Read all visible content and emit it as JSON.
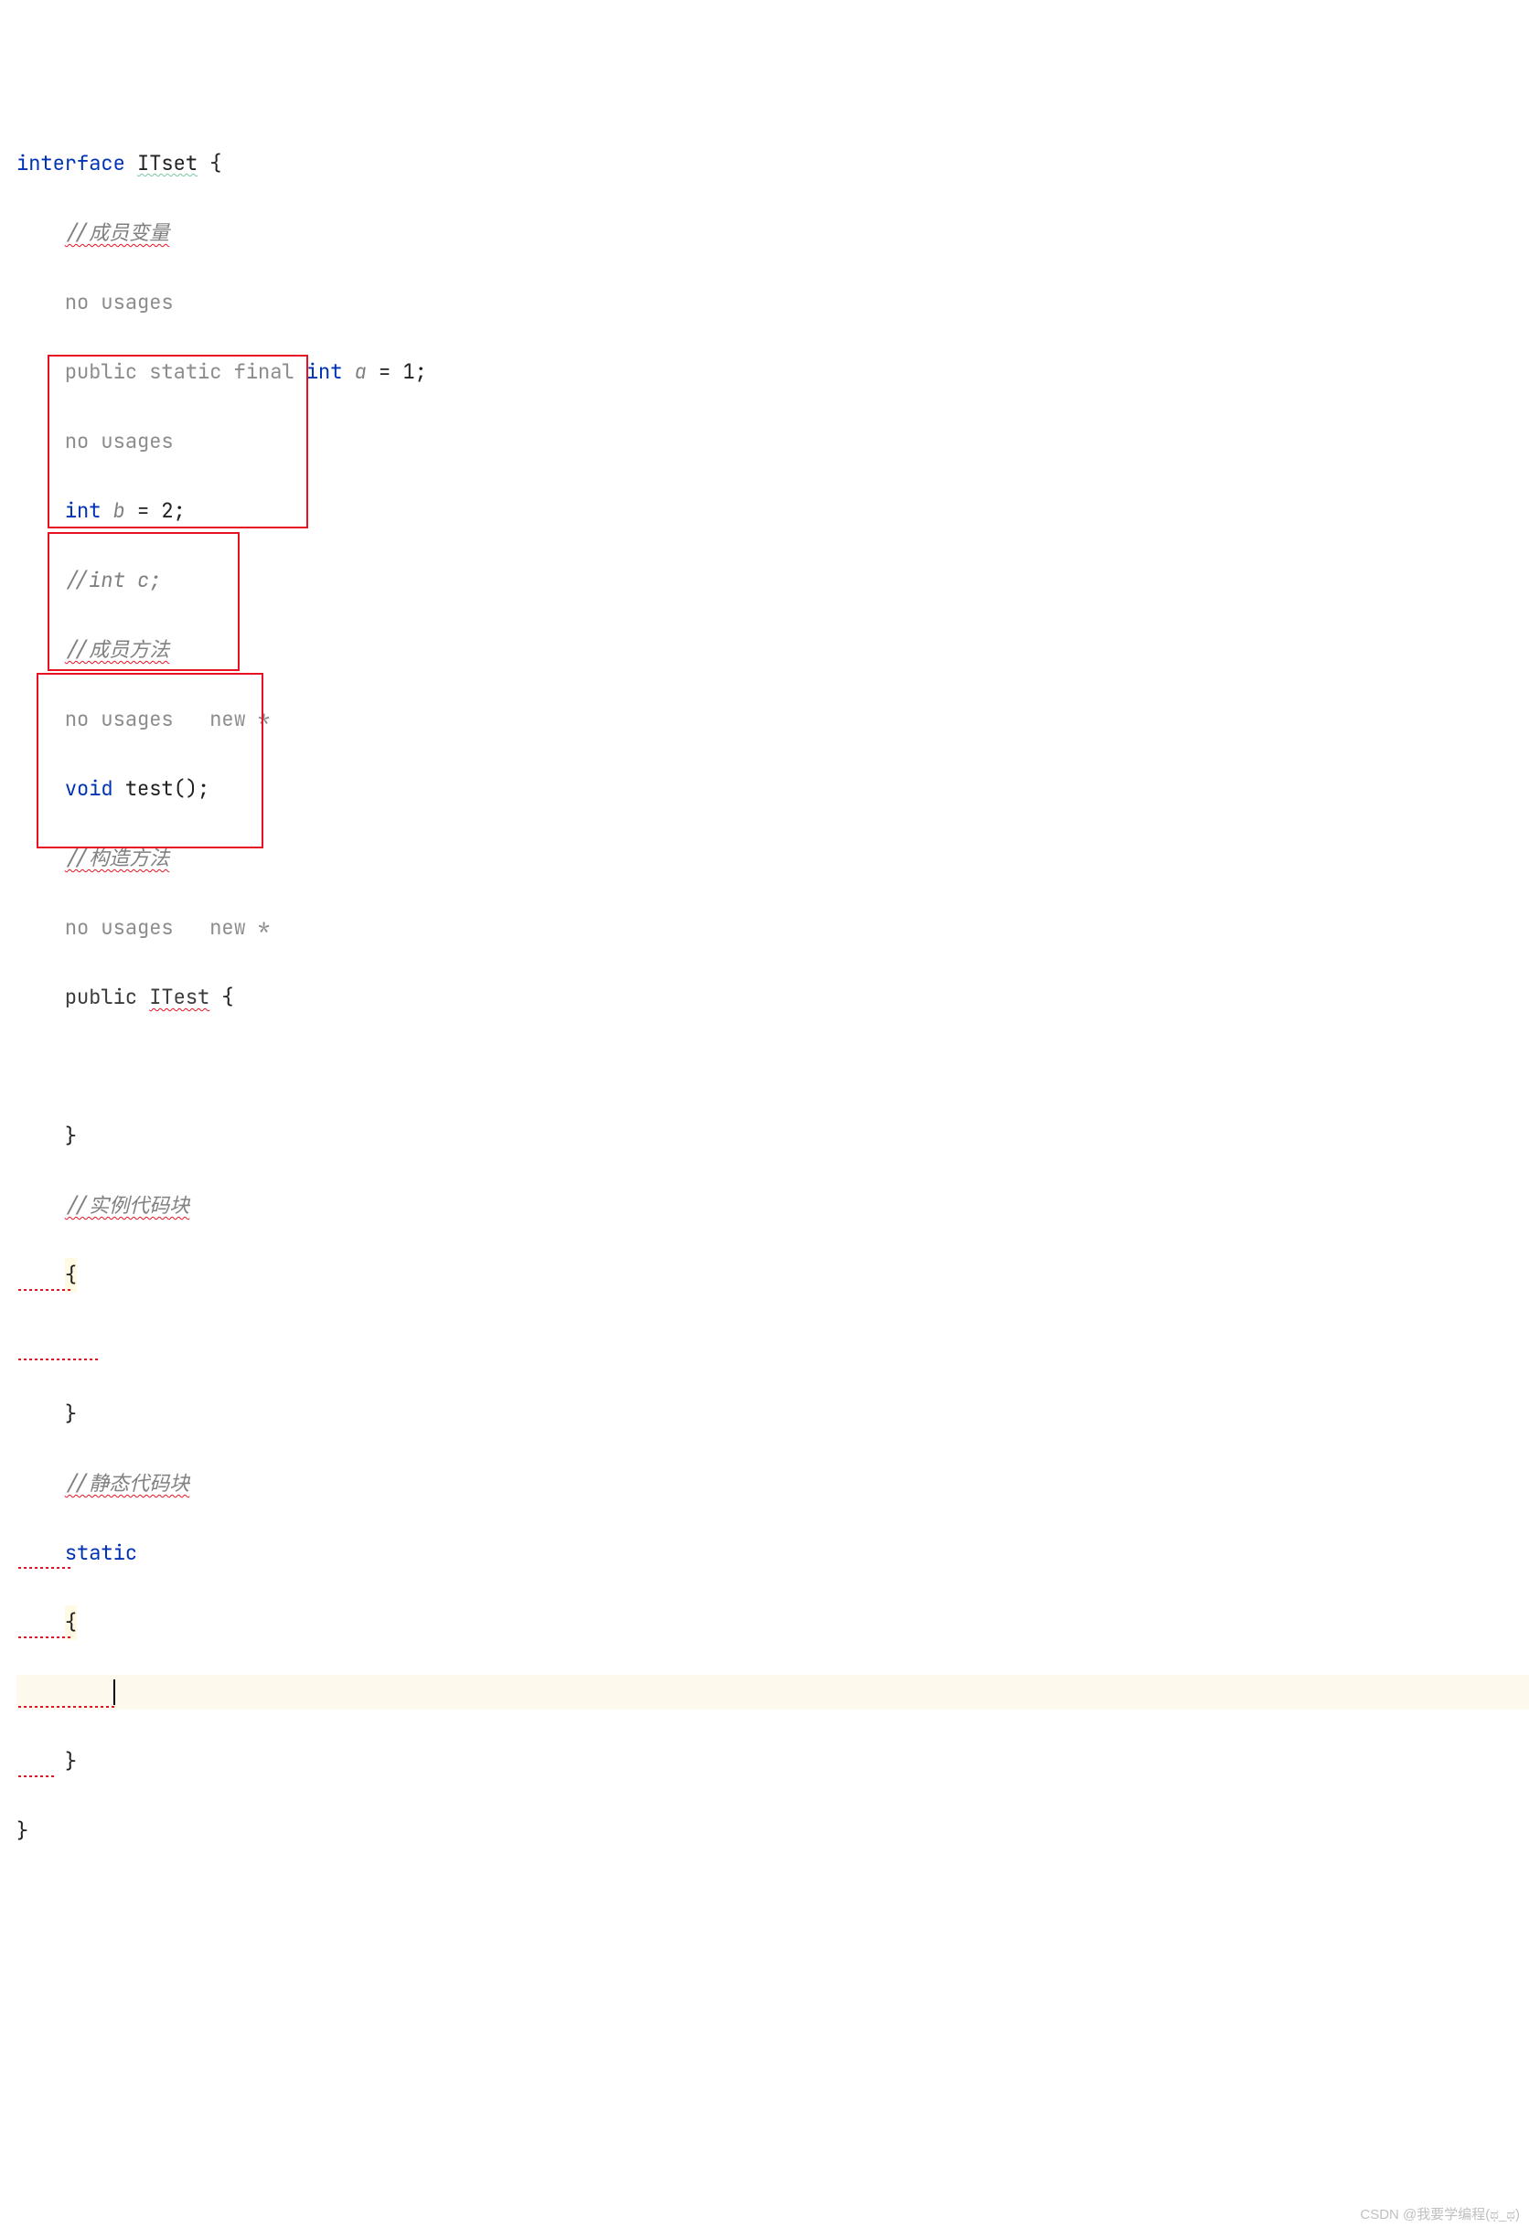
{
  "code": {
    "line1": {
      "kw1": "interface",
      "name": "ITset",
      "brace": "{"
    },
    "comment_var": "//成员变量",
    "no_usages1": "no usages",
    "decl_a": {
      "modifiers": "public static final ",
      "kw_int": "int",
      "name": " a ",
      "op": "=",
      "val": " 1",
      "semi": ";"
    },
    "no_usages2": "no usages",
    "decl_b": {
      "kw_int": "int",
      "name": " b ",
      "op": "=",
      "val": " 2",
      "semi": ";"
    },
    "comment_c": "//int c;",
    "comment_method": "//成员方法",
    "hints1": {
      "a": "no usages",
      "b": "new *"
    },
    "test_decl": {
      "kw_void": "void",
      "name": " test",
      "paren": "()",
      "semi": ";"
    },
    "comment_ctor": "//构造方法",
    "hints2": {
      "a": "no usages",
      "b": "new *"
    },
    "ctor_decl": {
      "mod": "public ",
      "name": "ITest",
      "brace": " {"
    },
    "close_brace1": "}",
    "comment_inst": "//实例代码块",
    "open_brace2": "{",
    "close_brace2": "}",
    "comment_static": "//静态代码块",
    "kw_static": "static",
    "open_brace3": "{",
    "close_brace3": "}",
    "final_brace": "}"
  },
  "watermark": "CSDN @我要学编程(ಥ_ಥ)"
}
